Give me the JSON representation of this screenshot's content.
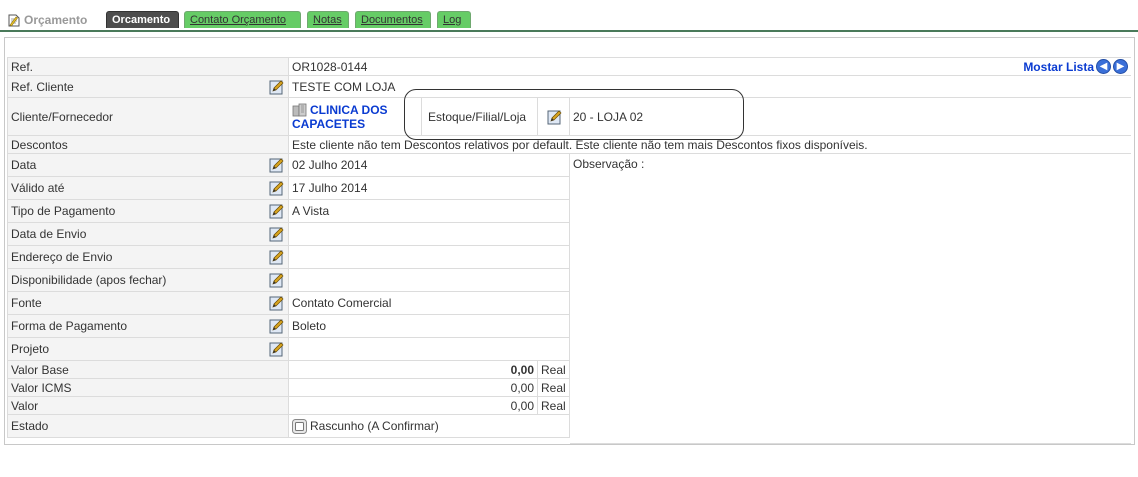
{
  "tabs": {
    "main_label": "Orçamento",
    "items": [
      {
        "label": "Orcamento",
        "active": true
      },
      {
        "label": "Contato Orçamento",
        "active": false
      },
      {
        "label": "Notas",
        "active": false
      },
      {
        "label": "Documentos",
        "active": false
      },
      {
        "label": "Log",
        "active": false
      }
    ]
  },
  "header": {
    "mostrar_lista": "Mostar Lista"
  },
  "rows": {
    "ref": {
      "label": "Ref.",
      "value": "OR1028-0144"
    },
    "ref_cliente": {
      "label": "Ref. Cliente",
      "value": "TESTE COM LOJA"
    },
    "cliente": {
      "label": "Cliente/Fornecedor",
      "value_line1": "CLINICA DOS",
      "value_line2": "CAPACETES"
    },
    "estoque": {
      "label": "Estoque/Filial/Loja",
      "value": "20 - LOJA 02"
    },
    "descontos": {
      "label": "Descontos",
      "value": "Este cliente não tem Descontos relativos por default. Este cliente não tem mais Descontos fixos disponíveis."
    },
    "data": {
      "label": "Data",
      "value": "02 Julho 2014"
    },
    "valido": {
      "label": "Válido até",
      "value": "17 Julho 2014"
    },
    "tipo_pagamento": {
      "label": "Tipo de Pagamento",
      "value": "A Vista"
    },
    "data_envio": {
      "label": "Data de Envio",
      "value": ""
    },
    "endereco_envio": {
      "label": "Endereço de Envio",
      "value": ""
    },
    "disponibilidade": {
      "label": "Disponibilidade (apos fechar)",
      "value": ""
    },
    "fonte": {
      "label": "Fonte",
      "value": "Contato Comercial"
    },
    "forma_pagamento": {
      "label": "Forma de Pagamento",
      "value": "Boleto"
    },
    "projeto": {
      "label": "Projeto",
      "value": ""
    },
    "valor_base": {
      "label": "Valor Base",
      "value": "0,00",
      "currency": "Real"
    },
    "valor_icms": {
      "label": "Valor ICMS",
      "value": "0,00",
      "currency": "Real"
    },
    "valor": {
      "label": "Valor",
      "value": "0,00",
      "currency": "Real"
    },
    "estado": {
      "label": "Estado",
      "value": "Rascunho (A Confirmar)"
    }
  },
  "observacao": {
    "label": "Observação :"
  },
  "colors": {
    "tab_green": "#66cc66",
    "tab_active": "#4d4d4d",
    "link_blue": "#0a3bd1"
  }
}
